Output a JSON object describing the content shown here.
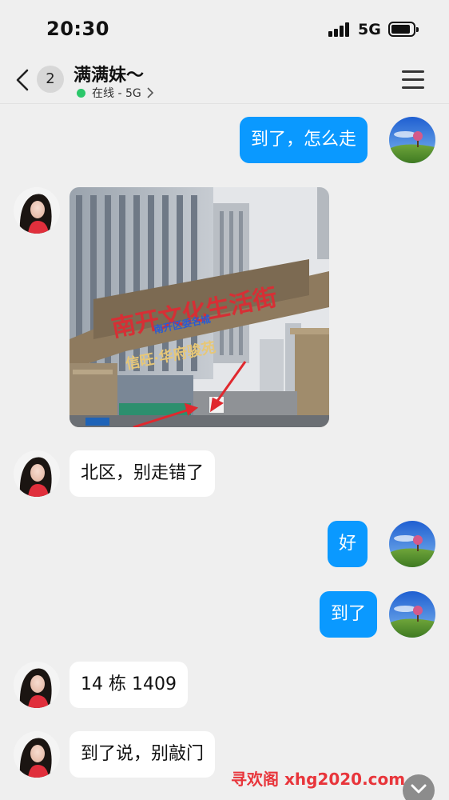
{
  "status_bar": {
    "time": "20:30",
    "network": "5G"
  },
  "header": {
    "unread_count": "2",
    "contact_name": "满满妹～",
    "status_text": "在线 - 5G"
  },
  "image_text": {
    "sign_main": "南开文化生活街",
    "sign_sub": "南开区委名城",
    "sign_third": "信旺·华府骏苑"
  },
  "messages": [
    {
      "direction": "out",
      "type": "text",
      "text": "到了，怎么走"
    },
    {
      "direction": "in",
      "type": "image"
    },
    {
      "direction": "in",
      "type": "text",
      "text": "北区，别走错了"
    },
    {
      "direction": "out",
      "type": "text",
      "text": "好"
    },
    {
      "direction": "out",
      "type": "text",
      "text": "到了"
    },
    {
      "direction": "in",
      "type": "text",
      "text": "14 栋 1409"
    },
    {
      "direction": "in",
      "type": "text",
      "text": "到了说，别敲门"
    }
  ],
  "watermark": "寻欢阁 xhg2020.com",
  "icons": [
    "back-chevron-icon",
    "menu-icon",
    "online-dot-icon",
    "chevron-right-icon",
    "chevron-down-icon",
    "signal-icon",
    "battery-icon"
  ],
  "colors": {
    "outgoing_bubble": "#0a99ff",
    "incoming_bubble": "#ffffff",
    "online": "#2bc76a",
    "background": "#efefef",
    "watermark": "#e8353b"
  }
}
